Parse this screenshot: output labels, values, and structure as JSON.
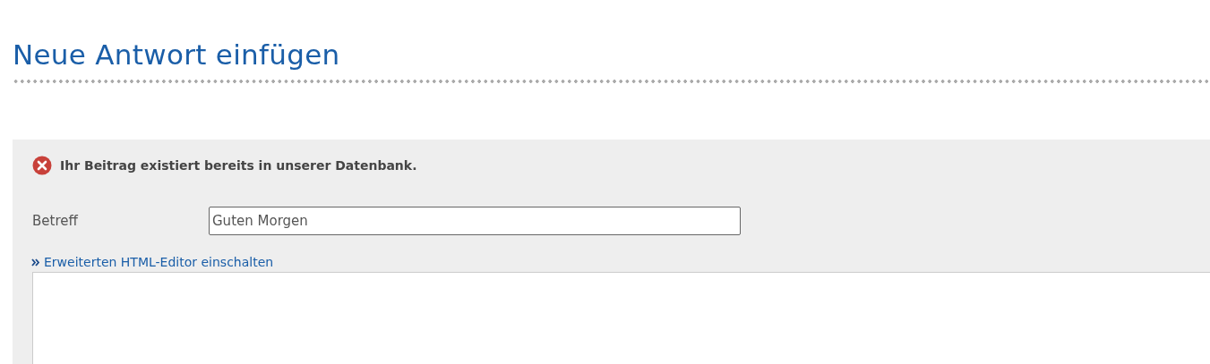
{
  "page": {
    "title": "Neue Antwort einfügen"
  },
  "error": {
    "message": "Ihr Beitrag existiert bereits in unserer Datenbank."
  },
  "form": {
    "subject_label": "Betreff",
    "subject_value": "Guten Morgen",
    "editor_link": "Erweiterten HTML-Editor einschalten"
  }
}
